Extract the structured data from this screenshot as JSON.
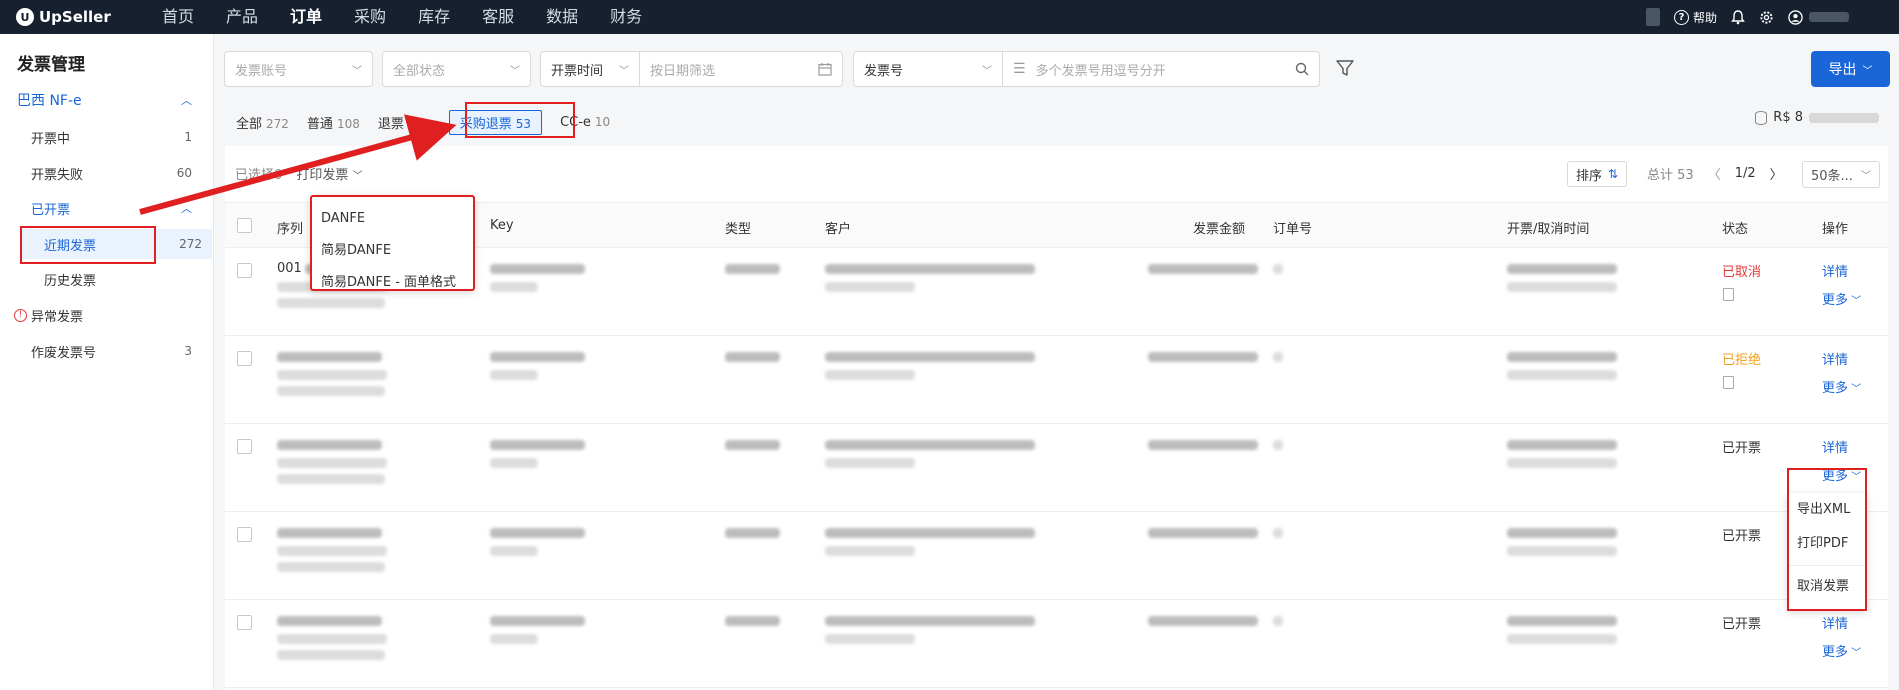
{
  "app": {
    "name": "UpSeller"
  },
  "nav": {
    "items": [
      "首页",
      "产品",
      "订单",
      "采购",
      "库存",
      "客服",
      "数据",
      "财务"
    ],
    "active_index": 2,
    "help_label": "帮助"
  },
  "sidebar": {
    "title": "发票管理",
    "group_label": "巴西 NF-e",
    "items": [
      {
        "label": "开票中",
        "count": "1"
      },
      {
        "label": "开票失败",
        "count": "60"
      },
      {
        "label": "已开票",
        "count": ""
      },
      {
        "label": "近期发票",
        "count": "272"
      },
      {
        "label": "历史发票",
        "count": ""
      },
      {
        "label": "异常发票",
        "count": ""
      },
      {
        "label": "作废发票号",
        "count": "3"
      }
    ]
  },
  "filters": {
    "account_placeholder": "发票账号",
    "status_placeholder": "全部状态",
    "time_label": "开票时间",
    "date_placeholder": "按日期筛选",
    "invoice_no_label": "发票号",
    "invoice_no_placeholder": "多个发票号用逗号分开",
    "export_label": "导出"
  },
  "tabs": [
    {
      "label": "全部",
      "count": "272"
    },
    {
      "label": "普通",
      "count": "108"
    },
    {
      "label": "退票",
      "count": "101"
    },
    {
      "label": "采购退票",
      "count": "53"
    },
    {
      "label": "CC-e",
      "count": "10"
    }
  ],
  "balance": {
    "prefix": "R$ 8"
  },
  "toolbar": {
    "selected_label": "已选择0",
    "print_label": "打印发票",
    "sort_label": "排序",
    "total_label": "总计 53",
    "page_label": "1/2",
    "page_size_label": "50条..."
  },
  "table": {
    "headers": {
      "seq": "序列",
      "key": "Key",
      "type": "类型",
      "customer": "客户",
      "amount": "发票金额",
      "order_no": "订单号",
      "time": "开票/取消时间",
      "status": "状态",
      "action": "操作"
    },
    "rows": [
      {
        "seq": "001",
        "status": "已取消",
        "status_color": "#e23a3a",
        "show_doc_icon": true
      },
      {
        "seq": "",
        "status": "已拒绝",
        "status_color": "#f0a020",
        "show_doc_icon": true
      },
      {
        "seq": "",
        "status": "已开票",
        "status_color": "#333333",
        "show_doc_icon": false
      },
      {
        "seq": "",
        "status": "已开票",
        "status_color": "#333333",
        "show_doc_icon": false
      },
      {
        "seq": "",
        "status": "已开票",
        "status_color": "#333333",
        "show_doc_icon": false
      }
    ],
    "detail_label": "详情",
    "more_label": "更多"
  },
  "print_menu": {
    "items": [
      "DANFE",
      "简易DANFE",
      "简易DANFE - 面单格式"
    ]
  },
  "more_menu": {
    "items": [
      "导出XML",
      "打印PDF",
      "取消发票"
    ]
  },
  "colors": {
    "primary": "#1a66d9",
    "nav_bg": "#16202f",
    "highlight": "#e02020"
  }
}
